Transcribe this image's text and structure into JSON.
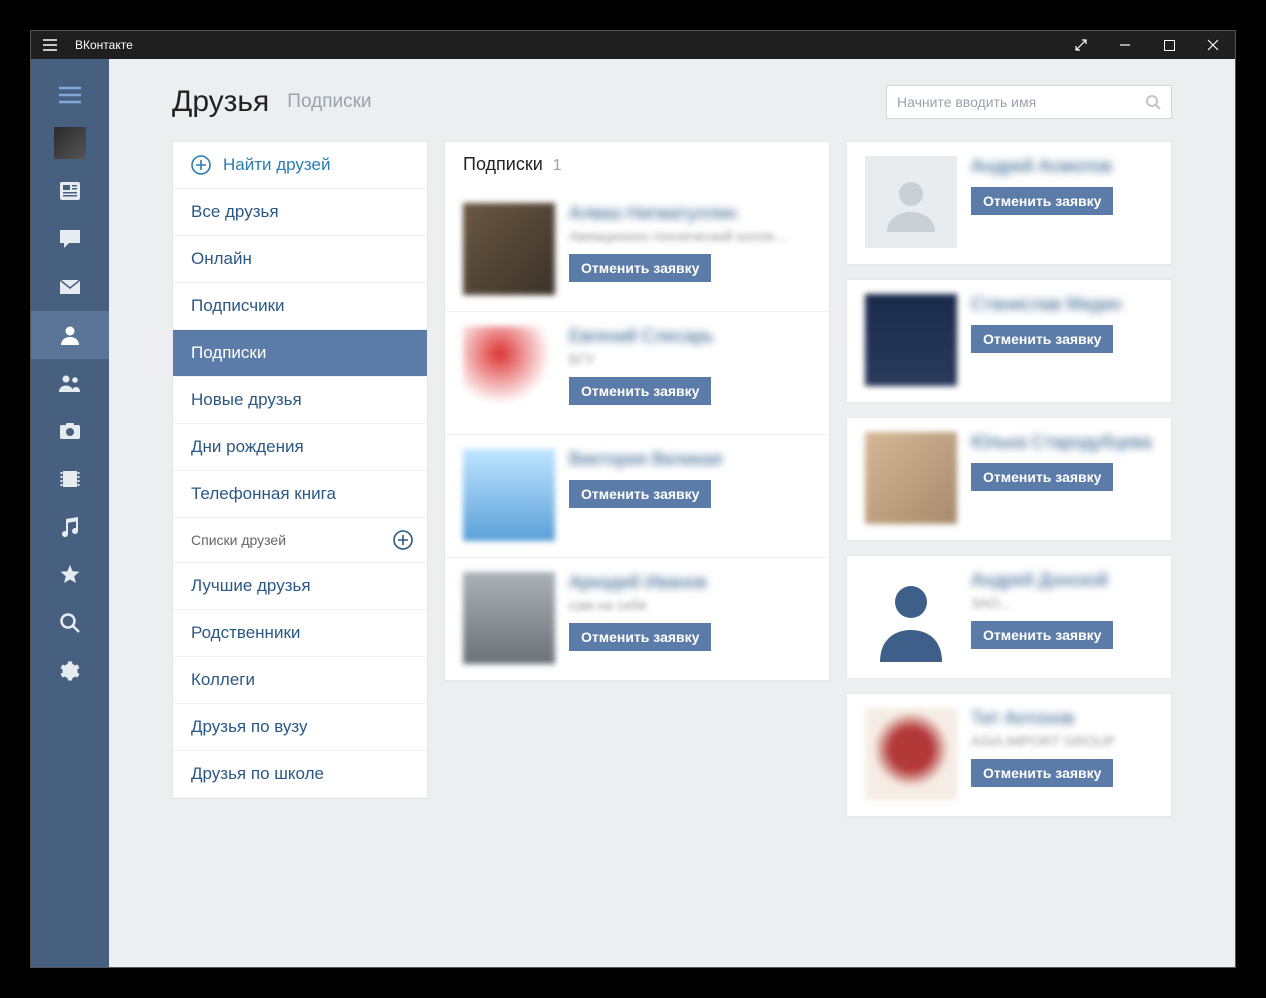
{
  "titlebar": {
    "app_name": "ВКонтакте"
  },
  "header": {
    "title": "Друзья",
    "subtitle": "Подписки"
  },
  "search": {
    "placeholder": "Начните вводить имя"
  },
  "sidemenu": {
    "find": "Найти друзей",
    "items": [
      "Все друзья",
      "Онлайн",
      "Подписчики",
      "Подписки",
      "Новые друзья",
      "Дни рождения",
      "Телефонная книга"
    ],
    "active_index": 3,
    "lists_header": "Списки друзей",
    "lists": [
      "Лучшие друзья",
      "Родственники",
      "Коллеги",
      "Друзья по вузу",
      "Друзья по школе"
    ]
  },
  "main_panel": {
    "title": "Подписки",
    "count": "1",
    "people": [
      {
        "name": "Алмаз Нигматуллин",
        "sub": "Авиационно-технический колледж...",
        "btn": "Отменить заявку"
      },
      {
        "name": "Евгений Слесарь",
        "sub": "БГУ",
        "btn": "Отменить заявку"
      },
      {
        "name": "Виктория Великая",
        "sub": "",
        "btn": "Отменить заявку"
      },
      {
        "name": "Аркадий Иванов",
        "sub": "сам на себя",
        "btn": "Отменить заявку"
      }
    ]
  },
  "right_panel": {
    "people": [
      {
        "name": "Андрей Асмолов",
        "sub": "",
        "btn": "Отменить заявку"
      },
      {
        "name": "Станислав Медин",
        "sub": "",
        "btn": "Отменить заявку"
      },
      {
        "name": "Юлька Стародубцева",
        "sub": "",
        "btn": "Отменить заявку"
      },
      {
        "name": "Андрей Донской",
        "sub": "ЗАО...",
        "btn": "Отменить заявку"
      },
      {
        "name": "Тит Антонов",
        "sub": "ASIA IMPORT GROUP",
        "btn": "Отменить заявку"
      }
    ]
  }
}
